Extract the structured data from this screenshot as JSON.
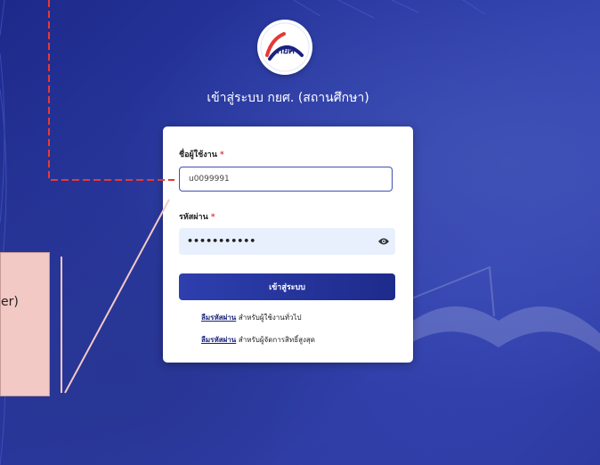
{
  "logo": {
    "text": "กยศ",
    "icon": "student-loan-fund-logo"
  },
  "page": {
    "title": "เข้าสู่ระบบ กยศ. (สถานศึกษา)"
  },
  "form": {
    "username_label": "ชื่อผู้ใช้งาน",
    "username_value": "u0099991",
    "required_mark": "*",
    "password_label": "รหัสผ่าน",
    "password_masked": "•••••••••••",
    "login_button": "เข้าสู่ระบบ"
  },
  "links": {
    "forgot_password": "ลืมรหัสผ่าน",
    "general_user_suffix": "สำหรับผู้ใช้งานทั่วไป",
    "super_admin_suffix": "สำหรับผู้จัดการสิทธิ์สูงสุด"
  },
  "callout": {
    "text": "er)"
  },
  "colors": {
    "brand": "#1a237e",
    "button": "#1e2b8c",
    "highlight": "#e53935",
    "callout_bg": "#f2c9c4"
  }
}
